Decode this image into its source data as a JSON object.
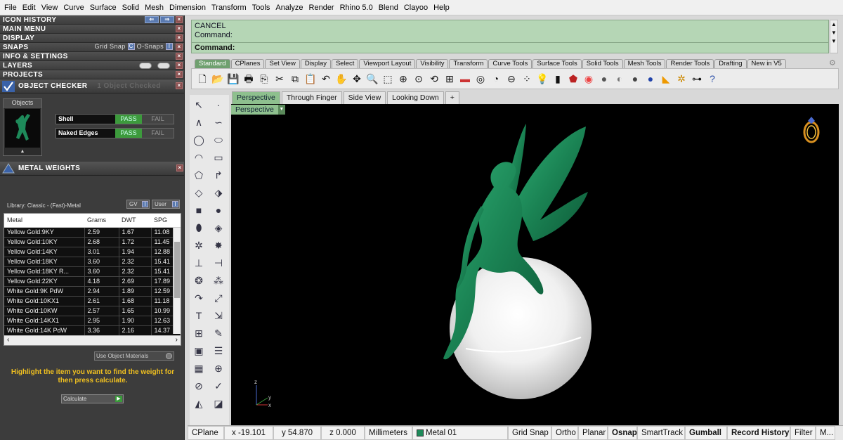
{
  "menubar": [
    "File",
    "Edit",
    "View",
    "Curve",
    "Surface",
    "Solid",
    "Mesh",
    "Dimension",
    "Transform",
    "Tools",
    "Analyze",
    "Render",
    "Rhino 5.0",
    "Blend",
    "Clayoo",
    "Help"
  ],
  "left_panel": {
    "rows": {
      "icon_history": "ICON HISTORY",
      "main_menu": "MAIN MENU",
      "display": "DISPLAY",
      "snaps": "SNAPS",
      "info_settings": "INFO & SETTINGS",
      "layers": "LAYERS",
      "projects": "PROJECTS"
    },
    "snaps_grid": "Grid Snap",
    "snaps_osnaps": "O-Snaps",
    "object_checker": {
      "title": "OBJECT CHECKER",
      "checked": "1 Object Checked",
      "objects_label": "Objects",
      "checks": [
        {
          "name": "Shell",
          "pass": "PASS",
          "fail": "FAIL"
        },
        {
          "name": "Naked Edges",
          "pass": "PASS",
          "fail": "FAIL"
        }
      ]
    },
    "metal_weights": {
      "title": "METAL WEIGHTS",
      "library": "Library: Classic - (Fast)-Metal",
      "gv": "GV",
      "user": "User",
      "columns": [
        "Metal",
        "Grams",
        "DWT",
        "SPG"
      ],
      "rows": [
        [
          "Yellow Gold:9KY",
          "2.59",
          "1.67",
          "11.08"
        ],
        [
          "Yellow Gold:10KY",
          "2.68",
          "1.72",
          "11.45"
        ],
        [
          "Yellow Gold:14KY",
          "3.01",
          "1.94",
          "12.88"
        ],
        [
          "Yellow Gold:18KY",
          "3.60",
          "2.32",
          "15.41"
        ],
        [
          "Yellow Gold:18KY R...",
          "3.60",
          "2.32",
          "15.41"
        ],
        [
          "Yellow Gold:22KY",
          "4.18",
          "2.69",
          "17.89"
        ],
        [
          "White Gold:9K PdW",
          "2.94",
          "1.89",
          "12.59"
        ],
        [
          "White Gold:10KX1",
          "2.61",
          "1.68",
          "11.18"
        ],
        [
          "White Gold:10KW",
          "2.57",
          "1.65",
          "10.99"
        ],
        [
          "White Gold:14KX1",
          "2.95",
          "1.90",
          "12.63"
        ],
        [
          "White Gold:14K PdW",
          "3.36",
          "2.16",
          "14.37"
        ]
      ],
      "use_object_materials": "Use Object Materials",
      "hint": "Highlight the item you want to find the weight for then press calculate.",
      "calculate": "Calculate"
    }
  },
  "command": {
    "line1": "CANCEL",
    "line2": "Command:",
    "prompt": "Command:"
  },
  "toolbar_tabs": [
    "Standard",
    "CPlanes",
    "Set View",
    "Display",
    "Select",
    "Viewport Layout",
    "Visibility",
    "Transform",
    "Curve Tools",
    "Surface Tools",
    "Solid Tools",
    "Mesh Tools",
    "Render Tools",
    "Drafting",
    "New in V5"
  ],
  "viewport_tabs": [
    "Perspective",
    "Through Finger",
    "Side View",
    "Looking Down",
    "+"
  ],
  "viewport": {
    "name": "Perspective",
    "axis_z": "z",
    "axis_x": "x",
    "axis_y": "y"
  },
  "status": {
    "cplane": "CPlane",
    "x": "x -19.101",
    "y": "y 54.870",
    "z": "z 0.000",
    "units": "Millimeters",
    "layer": "Metal 01",
    "grid_snap": "Grid Snap",
    "ortho": "Ortho",
    "planar": "Planar",
    "osnap": "Osnap",
    "smarttrack": "SmartTrack",
    "gumball": "Gumball",
    "record_history": "Record History",
    "filter": "Filter",
    "more": "M..."
  },
  "colors": {
    "figure": "#1e8a5a",
    "command_bg": "#b5d6b5",
    "active_tab": "#6fa06f",
    "pass": "#3c9a3c",
    "hint": "#f0c020"
  }
}
